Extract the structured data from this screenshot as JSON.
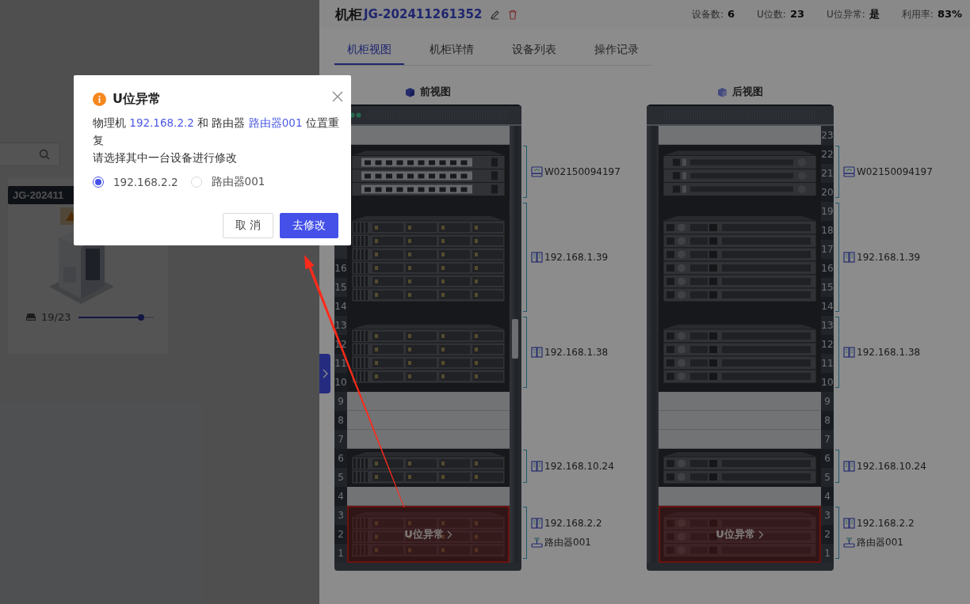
{
  "background": {
    "card": {
      "tag": "JG-202411",
      "usage": "19/23",
      "level": 0.83
    }
  },
  "drawer": {
    "title": "机柜",
    "code": "JG-202411261352",
    "stats": [
      {
        "label": "设备数:",
        "value": "6"
      },
      {
        "label": "U位数:",
        "value": "23"
      },
      {
        "label": "U位异常:",
        "value": "是"
      },
      {
        "label": "利用率:",
        "value": "83%"
      }
    ],
    "tabs": [
      {
        "label": "机柜视图",
        "selected": true
      },
      {
        "label": "机柜详情",
        "selected": false
      },
      {
        "label": "设备列表",
        "selected": false
      },
      {
        "label": "操作记录",
        "selected": false
      }
    ],
    "views": [
      {
        "title": "前视图",
        "kind": "front",
        "segments": [
          {
            "kind": "empty"
          },
          {
            "kind": "switch",
            "tags": [
              {
                "kind": "switch",
                "text": "W02150094197"
              }
            ]
          },
          {
            "kind": "server",
            "units": [
              "16",
              "15",
              "14"
            ],
            "tags": [
              {
                "kind": "server",
                "text": "192.168.1.39"
              }
            ]
          },
          {
            "kind": "server",
            "units": [
              "13",
              "12",
              "11",
              "10"
            ],
            "tags": [
              {
                "kind": "server",
                "text": "192.168.1.38"
              }
            ]
          },
          {
            "kind": "empty",
            "units": [
              "9"
            ]
          },
          {
            "kind": "empty",
            "units": [
              "8"
            ]
          },
          {
            "kind": "empty",
            "units": [
              "7"
            ]
          },
          {
            "kind": "server",
            "units": [
              "6",
              "5"
            ],
            "tags": [
              {
                "kind": "server",
                "text": "192.168.10.24"
              }
            ]
          },
          {
            "kind": "empty",
            "units": [
              "4"
            ]
          },
          {
            "kind": "server",
            "units": [
              "3",
              "2",
              "1"
            ],
            "abnormal": true,
            "alert": "U位异常",
            "tags": [
              {
                "kind": "server",
                "text": "192.168.2.2"
              },
              {
                "kind": "router",
                "text": "路由器001"
              }
            ]
          }
        ]
      },
      {
        "title": "后视图",
        "kind": "back",
        "segments": [
          {
            "kind": "empty",
            "units": [
              "23"
            ]
          },
          {
            "kind": "switch",
            "units": [
              "22",
              "21",
              "20"
            ],
            "tags": [
              {
                "kind": "switch",
                "text": "W02150094197"
              }
            ]
          },
          {
            "kind": "server",
            "units": [
              "19",
              "18",
              "17",
              "16",
              "15",
              "14"
            ],
            "tags": [
              {
                "kind": "server",
                "text": "192.168.1.39"
              }
            ]
          },
          {
            "kind": "server",
            "units": [
              "13",
              "12",
              "11",
              "10"
            ],
            "tags": [
              {
                "kind": "server",
                "text": "192.168.1.38"
              }
            ]
          },
          {
            "kind": "empty",
            "units": [
              "9"
            ]
          },
          {
            "kind": "empty",
            "units": [
              "8"
            ]
          },
          {
            "kind": "empty",
            "units": [
              "7"
            ]
          },
          {
            "kind": "server",
            "units": [
              "6",
              "5"
            ],
            "tags": [
              {
                "kind": "server",
                "text": "192.168.10.24"
              }
            ]
          },
          {
            "kind": "empty",
            "units": [
              "4"
            ]
          },
          {
            "kind": "server",
            "units": [
              "3",
              "2",
              "1"
            ],
            "abnormal": true,
            "alert": "U位异常",
            "tags": [
              {
                "kind": "server",
                "text": "192.168.2.2"
              },
              {
                "kind": "router",
                "text": "路由器001"
              }
            ]
          }
        ]
      }
    ]
  },
  "dialog": {
    "title": "U位异常",
    "message": [
      {
        "kind": "text",
        "text": "物理机 "
      },
      {
        "kind": "link",
        "text": "192.168.2.2"
      },
      {
        "kind": "text",
        "text": " 和 路由器 "
      },
      {
        "kind": "link",
        "text": "路由器001"
      },
      {
        "kind": "text",
        "text": " 位置重复"
      }
    ],
    "prompt": "请选择其中一台设备进行修改",
    "options": [
      {
        "label": "192.168.2.2",
        "selected": true
      },
      {
        "label": "路由器001",
        "selected": false
      }
    ],
    "buttons": [
      {
        "label": "取 消",
        "kind": "default"
      },
      {
        "label": "去修改",
        "kind": "primary"
      }
    ]
  }
}
